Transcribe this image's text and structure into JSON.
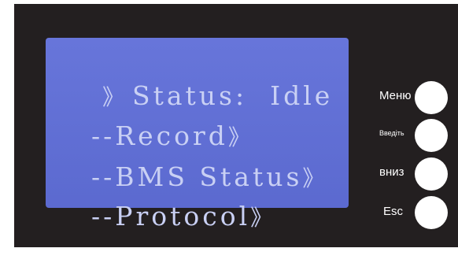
{
  "lcd": {
    "lines": [
      {
        "prefix": "》",
        "text": "Status:  Idle",
        "suffix": ""
      },
      {
        "prefix": "--",
        "text": "Record",
        "suffix": "》"
      },
      {
        "prefix": "--",
        "text": "BMS Status",
        "suffix": "》"
      },
      {
        "prefix": "--",
        "text": "Protocol",
        "suffix": "》"
      }
    ]
  },
  "buttons": [
    {
      "label": "Меню"
    },
    {
      "label": "Введіть"
    },
    {
      "label": "вниз"
    },
    {
      "label": "Esc"
    }
  ],
  "colors": {
    "panel": "#231f20",
    "lcd_background": "#5f6ed8",
    "lcd_text": "#c9d0f4",
    "button": "#ffffff"
  }
}
